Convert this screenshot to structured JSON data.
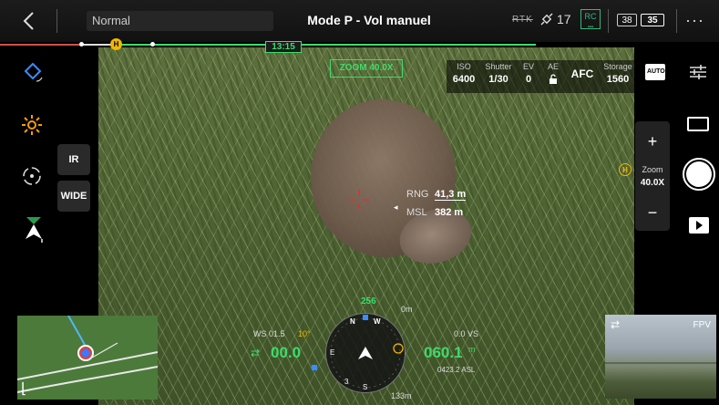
{
  "topbar": {
    "mode": "Normal",
    "title": "Mode P - Vol manuel",
    "rtk_label": "RTK",
    "satellites": "17",
    "rc_label": "RC",
    "battery_1": "38",
    "battery_2": "35",
    "menu_label": "···"
  },
  "flight": {
    "home_marker": "H",
    "flight_time": "13:15"
  },
  "left_panel": {
    "lens_ir": "IR",
    "lens_wide": "WIDE"
  },
  "camera": {
    "zoom_badge": "ZOOM 40.0X",
    "iso_label": "ISO",
    "iso_value": "6400",
    "shutter_label": "Shutter",
    "shutter_value": "1/30",
    "ev_label": "EV",
    "ev_value": "0",
    "ae_label": "AE",
    "focus_mode": "AFC",
    "storage_label": "Storage",
    "storage_value": "1560"
  },
  "zoom": {
    "plus": "+",
    "minus": "−",
    "label": "Zoom",
    "value": "40.0X",
    "home_marker": "H"
  },
  "target": {
    "rng_label": "RNG",
    "rng_value": "41,3 m",
    "msl_label": "MSL",
    "msl_value": "382 m"
  },
  "telemetry": {
    "heading": "256",
    "ws": "WS 01.5",
    "ws_dir": "10°",
    "speed": "00.0",
    "vs": "0.0 VS",
    "altitude": "060.1",
    "alt_unit": "m",
    "asl": "0423.2 ASL",
    "alt_marker": "0m",
    "distance": "133m",
    "compass_n": "N",
    "compass_w": "W",
    "compass_s": "S",
    "compass_e": "E",
    "compass_mark_3": "3"
  },
  "fpv": {
    "label": "FPV",
    "swap_icon": "⇄"
  },
  "map": {
    "corner": "⌊"
  },
  "colors": {
    "accent_green": "#3ddc6a",
    "home_yellow": "#f2b800",
    "warning_orange": "#f29d00",
    "track_red": "#d05050"
  }
}
